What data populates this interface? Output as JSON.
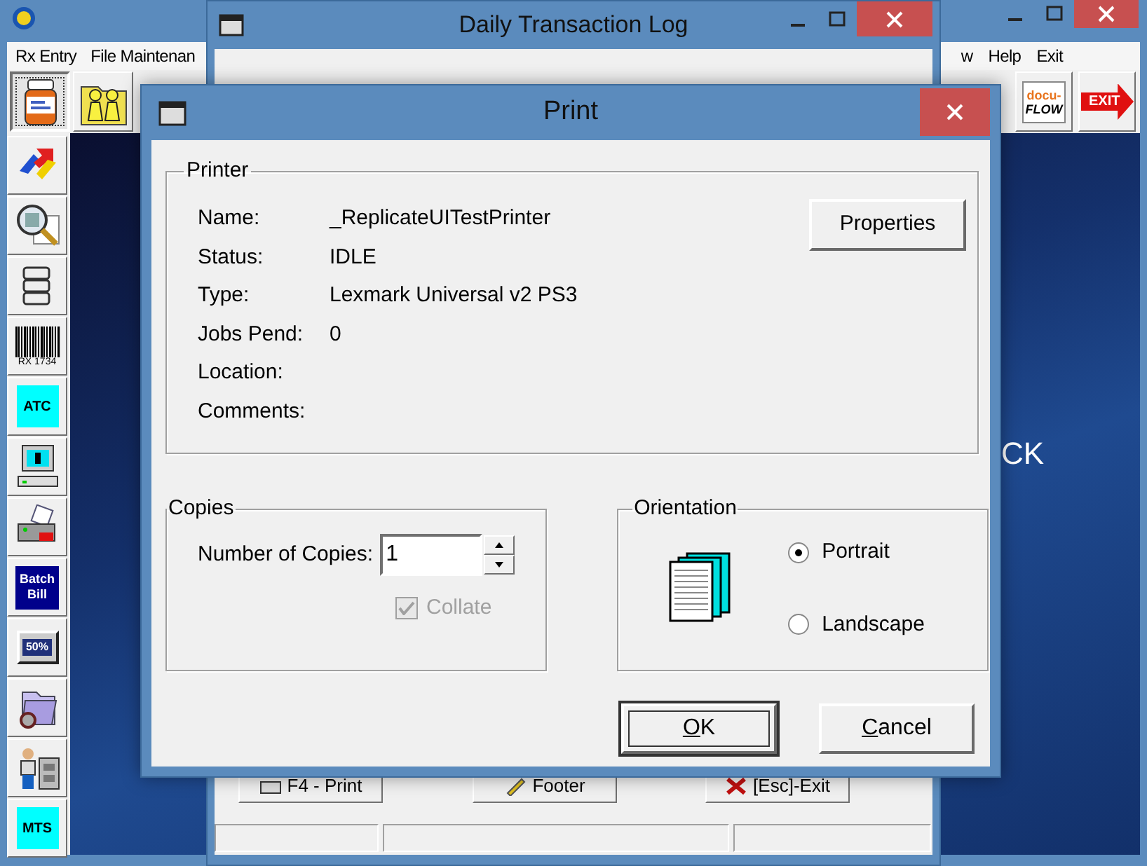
{
  "app_window": {
    "menu": [
      "Rx Entry",
      "File Maintenan"
    ],
    "menu_right": [
      "w",
      "Help",
      "Exit"
    ],
    "toolbar": [
      {
        "kind": "bottle",
        "pressed": true
      },
      {
        "kind": "family",
        "pressed": false
      }
    ],
    "toolbar_right": [
      {
        "kind": "docuflow",
        "label": "docu-",
        "label_2": "FLOW"
      },
      {
        "kind": "exit",
        "label": "EXIT"
      }
    ],
    "side_toolbar": [
      {
        "kind": "arrows"
      },
      {
        "kind": "magnifier"
      },
      {
        "kind": "drawers"
      },
      {
        "kind": "barcode",
        "label": "RX 1734"
      },
      {
        "kind": "tile",
        "label": "ATC"
      },
      {
        "kind": "computer"
      },
      {
        "kind": "printer"
      },
      {
        "kind": "badge",
        "label": "Batch Bill"
      },
      {
        "kind": "percent",
        "label": "50%"
      },
      {
        "kind": "folder"
      },
      {
        "kind": "worker"
      },
      {
        "kind": "tile",
        "label": "MTS"
      }
    ],
    "desktop_text": "CK"
  },
  "transaction_log": {
    "title": "Daily Transaction Log",
    "buttons": [
      {
        "kind": "print",
        "label": "F4 - Print"
      },
      {
        "kind": "footer",
        "label": "Footer"
      },
      {
        "kind": "exit",
        "label": "[Esc]-Exit"
      }
    ]
  },
  "print_dialog": {
    "title": "Print",
    "printer_group": "Printer",
    "fields": [
      {
        "label": "Name:",
        "value": "_ReplicateUITestPrinter"
      },
      {
        "label": "Status:",
        "value": "IDLE"
      },
      {
        "label": "Type:",
        "value": "Lexmark Universal v2 PS3"
      },
      {
        "label": "Jobs Pend:",
        "value": "0"
      },
      {
        "label": "Location:"
      },
      {
        "label": "Comments:"
      }
    ],
    "properties_button": "Properties",
    "copies_group": "Copies",
    "copies_label": "Number of Copies:",
    "copies_value": "1",
    "collate": {
      "label": "Collate",
      "checked": true,
      "disabled": true
    },
    "orientation_group": "Orientation",
    "orientations": [
      {
        "label": "Portrait",
        "selected": true
      },
      {
        "label": "Landscape",
        "selected": false
      }
    ],
    "buttons": [
      {
        "label": "OK",
        "default": true
      },
      {
        "label": "Cancel",
        "default": false
      }
    ]
  }
}
